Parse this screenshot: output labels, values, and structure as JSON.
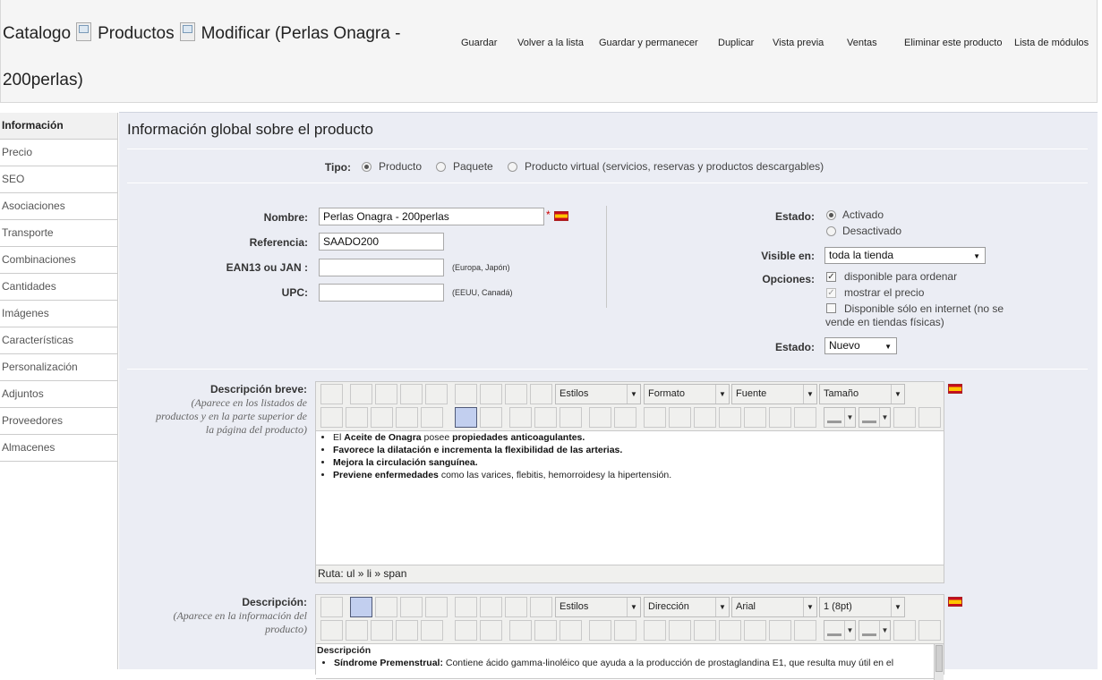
{
  "header": {
    "crumb_catalog": "Catalogo",
    "crumb_products": "Productos",
    "crumb_modify": "Modificar (Perlas Onagra -",
    "crumb_modify2": "200perlas)",
    "toolbar": [
      "Guardar",
      "Volver a la lista",
      "Guardar y permanecer",
      "Duplicar",
      "Vista previa",
      "Ventas",
      "Eliminar este producto",
      "Lista de módulos"
    ]
  },
  "sidebar": {
    "items": [
      "Información",
      "Precio",
      "SEO",
      "Asociaciones",
      "Transporte",
      "Combinaciones",
      "Cantidades",
      "Imágenes",
      "Características",
      "Personalización",
      "Adjuntos",
      "Proveedores",
      "Almacenes"
    ]
  },
  "main": {
    "title": "Información global sobre el producto",
    "tipo": {
      "label": "Tipo:",
      "options": [
        "Producto",
        "Paquete",
        "Producto virtual (servicios, reservas y productos descargables)"
      ],
      "selected": 0
    },
    "nombre": {
      "label": "Nombre:",
      "value": "Perlas Onagra - 200perlas",
      "required": "*"
    },
    "referencia": {
      "label": "Referencia:",
      "value": "SAADO200"
    },
    "ean": {
      "label": "EAN13 ou JAN :",
      "value": "",
      "note": "(Europa, Japón)"
    },
    "upc": {
      "label": "UPC:",
      "value": "",
      "note": "(EEUU, Canadá)"
    },
    "estado": {
      "label": "Estado:",
      "options": [
        "Activado",
        "Desactivado"
      ],
      "selected": 0
    },
    "visible": {
      "label": "Visible en:",
      "value": "toda la tienda"
    },
    "opciones": {
      "label": "Opciones:",
      "items": [
        "disponible para ordenar",
        "mostrar el precio",
        "Disponible sólo en internet (no se",
        "vende en tiendas físicas)"
      ]
    },
    "condicion": {
      "label": "Estado:",
      "value": "Nuevo"
    }
  },
  "desc_breve": {
    "label": "Descripción breve:",
    "hint_lines": [
      "(Aparece en los listados de",
      "productos y en la parte superior de",
      "la página del producto)"
    ],
    "dropdowns": [
      "Estilos",
      "Formato",
      "Fuente",
      "Tamaño"
    ],
    "content": [
      {
        "a": "El ",
        "b": "Aceite de Onagra",
        "c": " posee ",
        "d": "propiedades anticoagulantes."
      },
      {
        "a": "",
        "b": "Favorece la dilatación e incrementa la flexibilidad de las arterias.",
        "c": "",
        "d": ""
      },
      {
        "a": "",
        "b": "Mejora la circulación sanguínea.",
        "c": "",
        "d": ""
      },
      {
        "a": "",
        "b": "Previene enfermedades",
        "c": " como las varices, flebitis, hemorroidesy la hipertensión.",
        "d": ""
      }
    ],
    "ruta": "Ruta: ul » li » span"
  },
  "descripcion": {
    "label": "Descripción:",
    "hint_lines": [
      "(Aparece en la información del",
      "producto)"
    ],
    "dropdowns": [
      "Estilos",
      "Dirección",
      "Arial",
      "1 (8pt)"
    ],
    "heading": "Descripción",
    "item_bold": "Síndrome Premenstrual:",
    "item_text": " Contiene ácido gamma-linoléico que ayuda a la producción de prostaglandina E1, que resulta muy útil en el"
  },
  "colors": {
    "panel_bg": "#ebedf4",
    "header_bg": "#f5f5f5",
    "active_button": "#c2cfef"
  }
}
